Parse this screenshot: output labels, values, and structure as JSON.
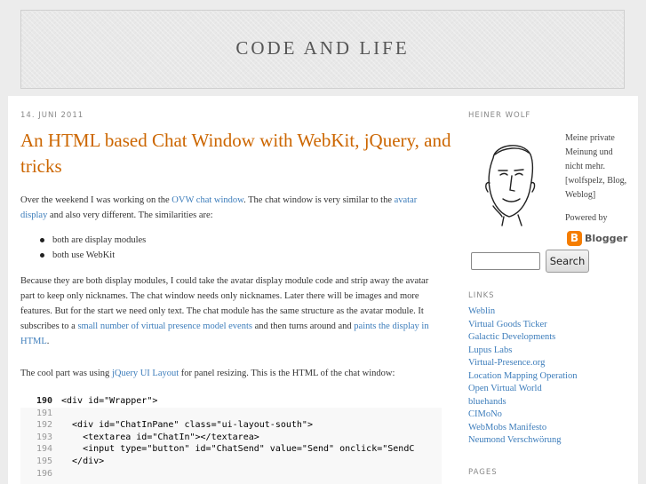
{
  "blog": {
    "title": "CODE AND LIFE"
  },
  "post": {
    "date": "14. JUNI 2011",
    "title": "An HTML based Chat Window with WebKit, jQuery, and tricks",
    "p1": {
      "t1": "Over the weekend I was working on the ",
      "link1": "OVW chat window",
      "t2": ". The chat window is very similar to the ",
      "link2": "avatar display",
      "t3": " and also very different. The similarities are:"
    },
    "bullets": [
      "both are display modules",
      "both use WebKit"
    ],
    "p2": {
      "t1": "Because they are both display modules, I could take the avatar display module code and strip away the avatar part to keep only nicknames. The chat window needs only nicknames. Later there will be images and more features. But for the start we need only text. The chat module has the same structure as the avatar module. It subscribes to a ",
      "link1": "small number of virtual presence model events",
      "t2": " and then turns around and ",
      "link2": "paints the display in HTML",
      "t3": "."
    },
    "p3": {
      "t1": "The cool part was using ",
      "link1": "jQuery UI Layout",
      "t2": " for panel resizing. This is the HTML of the chat window:"
    },
    "code": [
      {
        "num": "190",
        "text": "<div id=\"Wrapper\">"
      },
      {
        "num": "191",
        "text": ""
      },
      {
        "num": "192",
        "text": "  <div id=\"ChatInPane\" class=\"ui-layout-south\">"
      },
      {
        "num": "193",
        "text": "    <textarea id=\"ChatIn\"></textarea>"
      },
      {
        "num": "194",
        "text": "    <input type=\"button\" id=\"ChatSend\" value=\"Send\" onclick=\"SendC"
      },
      {
        "num": "195",
        "text": "  </div>"
      },
      {
        "num": "196",
        "text": ""
      }
    ]
  },
  "sidebar": {
    "profile_heading": "HEINER WOLF",
    "profile_text": "Meine private Meinung und nicht mehr. [wolfspelz, Blog, Weblog]",
    "powered_by": "Powered by",
    "blogger_logo_text": "Blogger",
    "search_button": "Search",
    "search_value": "",
    "links_heading": "LINKS",
    "links": [
      "Weblin",
      "Virtual Goods Ticker",
      "Galactic Developments",
      "Lupus Labs",
      "Virtual-Presence.org",
      "Location Mapping Operation",
      "Open Virtual World",
      "bluehands",
      "CIMoNo",
      "WebMobs Manifesto",
      "Neumond Verschwörung"
    ],
    "pages_heading": "PAGES"
  },
  "colors": {
    "title_orange": "#cc6600",
    "link_blue": "#3d7dbb",
    "page_bg": "#ececec"
  }
}
